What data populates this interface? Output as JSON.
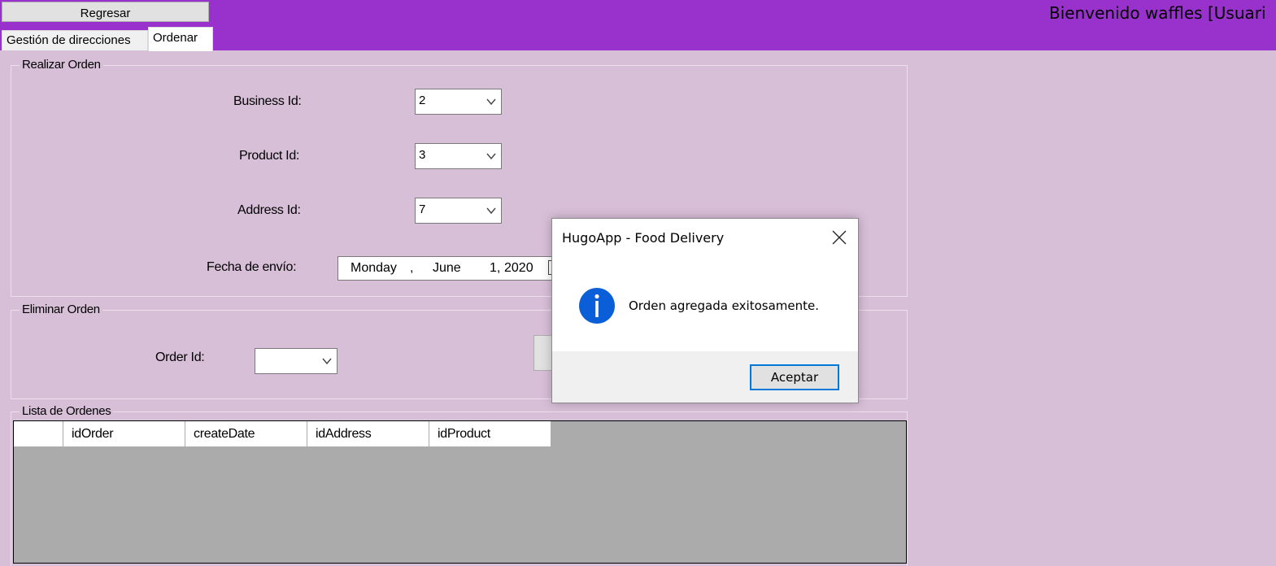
{
  "header": {
    "back_button": "Regresar",
    "welcome": "Bienvenido waffles [Usuari"
  },
  "tabs": [
    {
      "label": "Gestión de direcciones",
      "active": false
    },
    {
      "label": "Ordenar",
      "active": true
    }
  ],
  "realizar_orden": {
    "title": "Realizar Orden",
    "business_label": "Business Id:",
    "business_value": "2",
    "product_label": "Product Id:",
    "product_value": "3",
    "address_label": "Address Id:",
    "address_value": "7",
    "fecha_label": "Fecha de envío:",
    "fecha": {
      "day_name": "Monday",
      "sep": ",",
      "month": "June",
      "day": "1,",
      "year": "2020"
    }
  },
  "eliminar_orden": {
    "title": "Eliminar Orden",
    "order_label": "Order Id:",
    "order_value": ""
  },
  "lista_ordenes": {
    "title": "Lista de Ordenes",
    "columns": [
      "idOrder",
      "createDate",
      "idAddress",
      "idProduct"
    ],
    "rows": []
  },
  "dialog": {
    "title": "HugoApp - Food Delivery",
    "message": "Orden agregada exitosamente.",
    "ok_label": "Aceptar",
    "icon": "info-icon"
  },
  "colors": {
    "header_bg": "#9932cc",
    "body_bg": "#d8bfd8",
    "grid_bg": "#ababab",
    "accent": "#0078d7"
  }
}
